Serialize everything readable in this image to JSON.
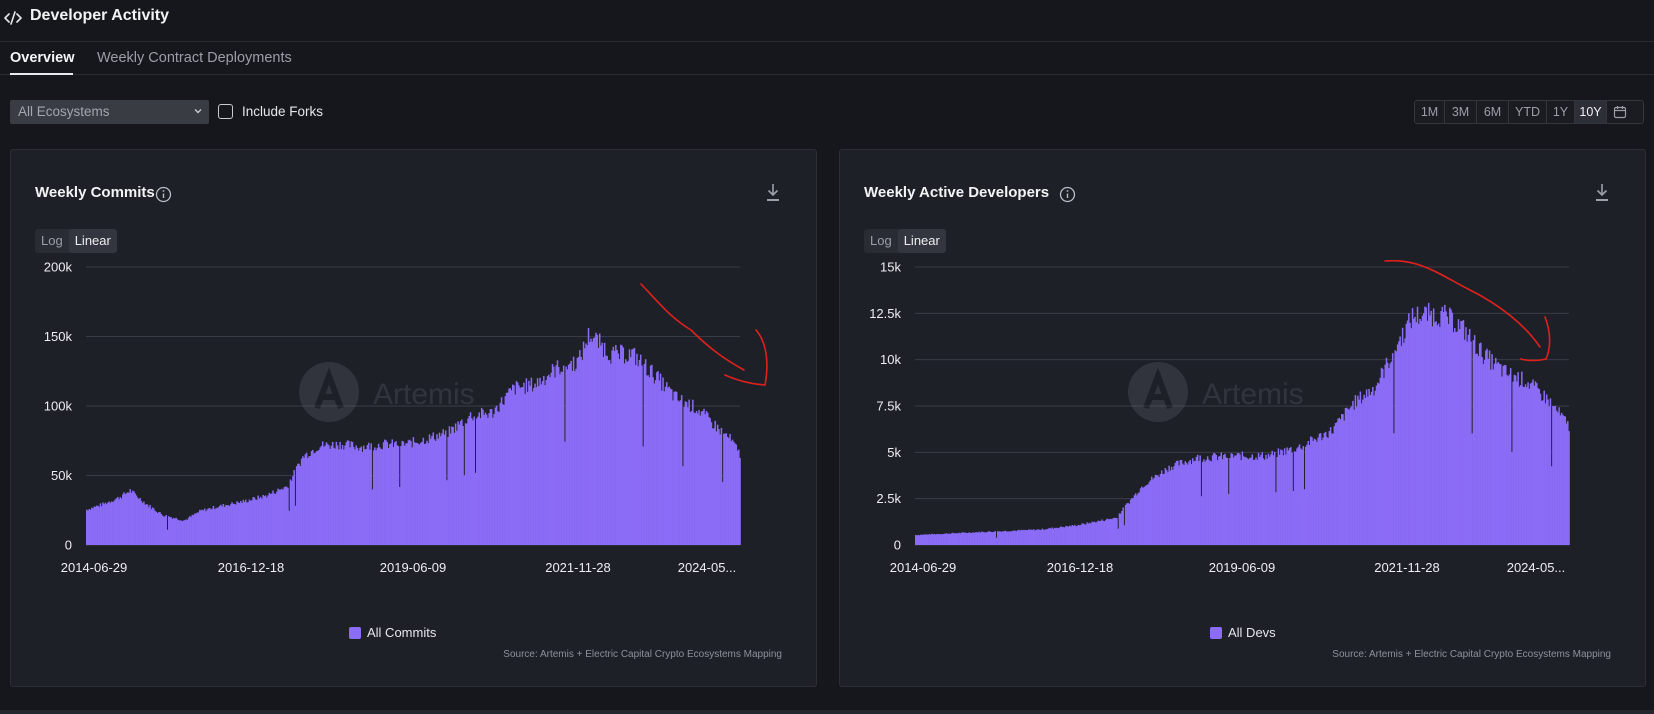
{
  "header": {
    "title": "Developer Activity",
    "icon": "code-icon"
  },
  "tabs": [
    {
      "label": "Overview",
      "active": true
    },
    {
      "label": "Weekly Contract Deployments",
      "active": false
    }
  ],
  "filters": {
    "ecosystem_select": "All Ecosystems",
    "include_forks_label": "Include Forks",
    "include_forks_checked": false
  },
  "ranges": [
    {
      "label": "1M",
      "active": false
    },
    {
      "label": "3M",
      "active": false
    },
    {
      "label": "6M",
      "active": false
    },
    {
      "label": "YTD",
      "active": false
    },
    {
      "label": "1Y",
      "active": false
    },
    {
      "label": "10Y",
      "active": true
    }
  ],
  "colors": {
    "bar": "#8b6cf7",
    "background": "#16171c",
    "panel": "#1e2028",
    "annotation": "#e0201c"
  },
  "panels": [
    {
      "title": "Weekly Commits",
      "scale_options": [
        "Log",
        "Linear"
      ],
      "active_scale": "Linear",
      "legend": "All Commits",
      "source": "Source: Artemis + Electric Capital Crypto Ecosystems Mapping",
      "watermark": "Artemis"
    },
    {
      "title": "Weekly Active Developers",
      "scale_options": [
        "Log",
        "Linear"
      ],
      "active_scale": "Linear",
      "legend": "All Devs",
      "source": "Source: Artemis + Electric Capital Crypto Ecosystems Mapping",
      "watermark": "Artemis"
    }
  ],
  "chart_data": [
    {
      "type": "bar",
      "title": "Weekly Commits",
      "series": [
        {
          "name": "All Commits"
        }
      ],
      "ylim": [
        0,
        200000
      ],
      "y_ticks": [
        "0",
        "50k",
        "100k",
        "150k",
        "200k"
      ],
      "x_ticks": [
        "2014-06-29",
        "2016-12-18",
        "2019-06-09",
        "2021-11-28",
        "2024-05..."
      ],
      "x_range": [
        "2014-06-29",
        "2024-08"
      ],
      "grid": true,
      "legend_position": "bottom",
      "points": [
        [
          "2014-06-29",
          26000
        ],
        [
          "2014-10",
          30000
        ],
        [
          "2015-01",
          35000
        ],
        [
          "2015-03",
          40000
        ],
        [
          "2015-06",
          30000
        ],
        [
          "2015-09",
          22000
        ],
        [
          "2016-01",
          18000
        ],
        [
          "2016-04",
          25000
        ],
        [
          "2016-07",
          28000
        ],
        [
          "2016-12",
          32000
        ],
        [
          "2017-04",
          36000
        ],
        [
          "2017-08",
          43000
        ],
        [
          "2017-11",
          65000
        ],
        [
          "2018-02",
          73000
        ],
        [
          "2018-06",
          74000
        ],
        [
          "2018-10",
          72000
        ],
        [
          "2019-02",
          74000
        ],
        [
          "2019-06",
          74000
        ],
        [
          "2019-10",
          78000
        ],
        [
          "2020-02",
          83000
        ],
        [
          "2020-06",
          95000
        ],
        [
          "2020-10",
          97000
        ],
        [
          "2021-02",
          115000
        ],
        [
          "2021-06",
          118000
        ],
        [
          "2021-10",
          130000
        ],
        [
          "2022-02",
          135000
        ],
        [
          "2022-04",
          155000
        ],
        [
          "2022-08",
          140000
        ],
        [
          "2022-12",
          140000
        ],
        [
          "2023-04",
          125000
        ],
        [
          "2023-08",
          108000
        ],
        [
          "2023-12",
          100000
        ],
        [
          "2024-04",
          85000
        ],
        [
          "2024-06",
          78000
        ],
        [
          "2024-08",
          66000
        ]
      ]
    },
    {
      "type": "bar",
      "title": "Weekly Active Developers",
      "series": [
        {
          "name": "All Devs"
        }
      ],
      "ylim": [
        0,
        15000
      ],
      "y_ticks": [
        "0",
        "2.5k",
        "5k",
        "7.5k",
        "10k",
        "12.5k",
        "15k"
      ],
      "x_ticks": [
        "2014-06-29",
        "2016-12-18",
        "2019-06-09",
        "2021-11-28",
        "2024-05..."
      ],
      "x_range": [
        "2014-06-29",
        "2024-08"
      ],
      "grid": true,
      "legend_position": "bottom",
      "points": [
        [
          "2014-06-29",
          550
        ],
        [
          "2015-06",
          700
        ],
        [
          "2016-06",
          850
        ],
        [
          "2017-01",
          1100
        ],
        [
          "2017-08",
          1500
        ],
        [
          "2018-01",
          3300
        ],
        [
          "2018-06",
          4300
        ],
        [
          "2018-11",
          4800
        ],
        [
          "2019-06",
          4900
        ],
        [
          "2019-12",
          4900
        ],
        [
          "2020-06",
          5400
        ],
        [
          "2020-12",
          6300
        ],
        [
          "2021-04",
          7800
        ],
        [
          "2021-08",
          8700
        ],
        [
          "2021-12",
          11000
        ],
        [
          "2022-03",
          12600
        ],
        [
          "2022-06",
          12700
        ],
        [
          "2022-09",
          12600
        ],
        [
          "2022-12",
          12000
        ],
        [
          "2023-04",
          10500
        ],
        [
          "2023-08",
          9500
        ],
        [
          "2023-12",
          9000
        ],
        [
          "2024-04",
          8000
        ],
        [
          "2024-08",
          6500
        ]
      ]
    }
  ]
}
